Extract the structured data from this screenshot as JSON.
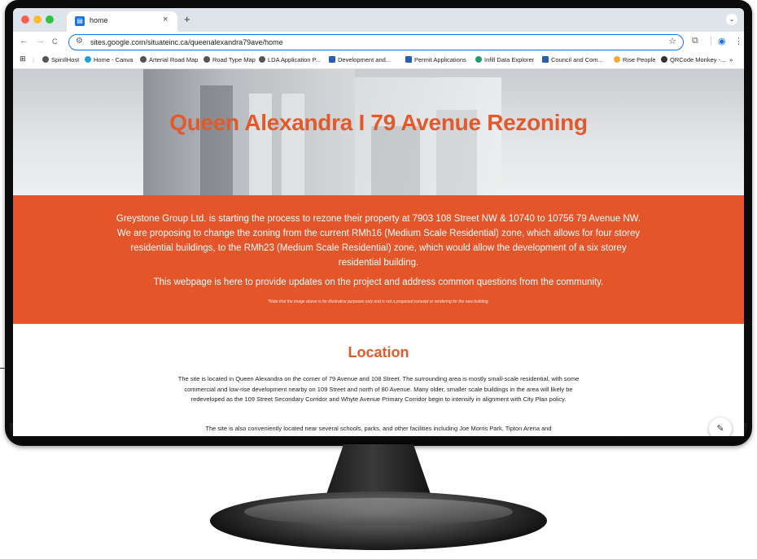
{
  "browser": {
    "tab_title": "home",
    "tab_close": "×",
    "new_tab": "+",
    "url": "sites.google.com/situateinc.ca/queenalexandra79ave/home",
    "back": "←",
    "forward": "→",
    "reload": "C",
    "star": "☆",
    "overflow": "»",
    "bookmarks": [
      "SpinIlHost",
      "Home - Canva",
      "Arterial Road Map",
      "Road Type Map",
      "LDA Application P...",
      "Development and...",
      "Permit Applications",
      "Infill Data Explorer",
      "Council and Com...",
      "Rise People",
      "QRCode Monkey -..."
    ]
  },
  "page": {
    "hero_title": "Queen Alexandra I 79 Avenue Rezoning",
    "intro": "Greystone Group Ltd. is starting the process to rezone their property at 7903 108 Street NW & 10740 to 10756 79 Avenue NW. We are proposing to change the zoning from the current RMh16 (Medium Scale Residential) zone, which allows for four storey residential buildings, to the RMh23 (Medium Scale Residential) zone, which would allow the development of a six storey residential building.",
    "purpose": "This webpage is here to provide updates on the project and address common questions from the community.",
    "note": "*Note that the image above is for illustrative purposes only and is not a proposed concept or rendering for the new building.",
    "location_heading": "Location",
    "location_p1": "The site is located in Queen Alexandra on the corner of 79 Avenue and 108 Street. The surrounding area is mostly small-scale residential, with some commercial and low-rise development nearby on 109 Street and north of 80 Avenue. Many older, smaller scale buildings in the area will likely be redeveloped as the 109 Street Secondary Corridor and Whyte Avenue Primary Corridor begin to intensify in alignment with City Plan policy.",
    "location_p2": "The site is also conveniently located near several schools, parks, and other facilities including Joe Morris Park, Tipton Arena and"
  },
  "colors": {
    "accent": "#e4552a",
    "title": "#e25a2c"
  }
}
